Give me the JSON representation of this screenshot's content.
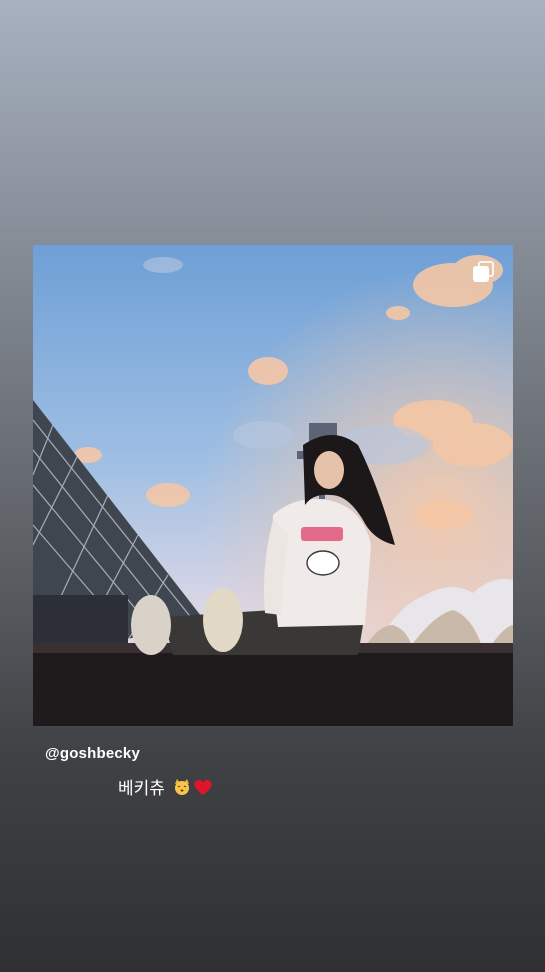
{
  "story": {
    "mention": "@goshbecky",
    "caption": "베키츄",
    "emojis": [
      "kissing-cat-emoji",
      "red-heart-emoji"
    ],
    "post_icon": "multiple-photos-icon"
  },
  "colors": {
    "background_top": "#a7b1c0",
    "background_bottom": "#2f3032",
    "text": "#ffffff",
    "heart": "#e0142b"
  }
}
